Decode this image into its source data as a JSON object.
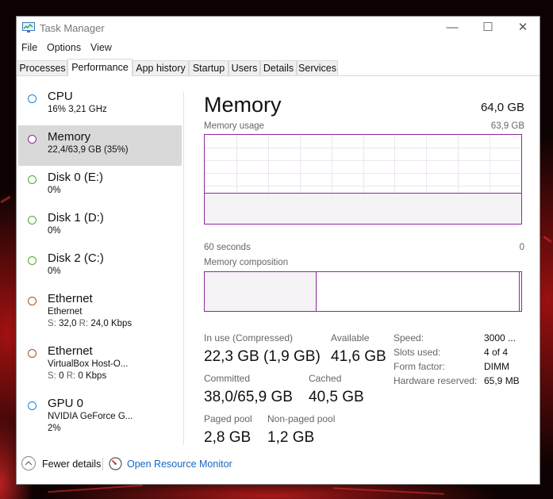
{
  "window": {
    "title": "Task Manager",
    "controls": {
      "minimize": "—",
      "maximize": "☐",
      "close": "✕"
    }
  },
  "menu": [
    "File",
    "Options",
    "View"
  ],
  "tabs": [
    "Processes",
    "Performance",
    "App history",
    "Startup",
    "Users",
    "Details",
    "Services"
  ],
  "active_tab": "Performance",
  "sidebar": {
    "items": [
      {
        "name": "CPU",
        "line1": "16% 3,21 GHz",
        "line2": "",
        "line3": "",
        "color": "#1f82d2"
      },
      {
        "name": "Memory",
        "line1": "22,4/63,9 GB (35%)",
        "line2": "",
        "line3": "",
        "color": "#8b2a9a",
        "selected": true
      },
      {
        "name": "Disk 0 (E:)",
        "line1": "0%",
        "line2": "",
        "line3": "",
        "color": "#4daa2b"
      },
      {
        "name": "Disk 1 (D:)",
        "line1": "0%",
        "line2": "",
        "line3": "",
        "color": "#4daa2b"
      },
      {
        "name": "Disk 2 (C:)",
        "line1": "0%",
        "line2": "",
        "line3": "",
        "color": "#4daa2b"
      },
      {
        "name": "Ethernet",
        "line1": "Ethernet",
        "line2_s_label": "S:",
        "line2_s": "32,0",
        "line2_r_label": "R:",
        "line2_r": "24,0 Kbps",
        "color": "#a7521e"
      },
      {
        "name": "Ethernet",
        "line1": "VirtualBox Host-O...",
        "line2_s_label": "S:",
        "line2_s": "0",
        "line2_r_label": "R:",
        "line2_r": "0 Kbps",
        "color": "#a7521e"
      },
      {
        "name": "GPU 0",
        "line1": "NVIDIA GeForce G...",
        "line2": "2%",
        "line3": "",
        "color": "#1f82d2"
      }
    ]
  },
  "memory": {
    "title": "Memory",
    "capacity": "64,0 GB",
    "usage_label": "Memory usage",
    "usage_max": "63,9 GB",
    "time_left": "60 seconds",
    "time_right": "0",
    "usage_fraction": 0.35,
    "composition_label": "Memory composition",
    "composition_in_use_fraction": 0.35,
    "composition_modified_fraction": 0.005,
    "in_use_label": "In use (Compressed)",
    "in_use_value": "22,3 GB (1,9 GB)",
    "available_label": "Available",
    "available_value": "41,6 GB",
    "committed_label": "Committed",
    "committed_value": "38,0/65,9 GB",
    "cached_label": "Cached",
    "cached_value": "40,5 GB",
    "paged_label": "Paged pool",
    "paged_value": "2,8 GB",
    "nonpaged_label": "Non-paged pool",
    "nonpaged_value": "1,2 GB",
    "speed_label": "Speed:",
    "speed_value": "3000 ...",
    "slots_label": "Slots used:",
    "slots_value": "4 of 4",
    "form_label": "Form factor:",
    "form_value": "DIMM",
    "hwres_label": "Hardware reserved:",
    "hwres_value": "65,9 MB",
    "accent": "#8b2a9a",
    "fill": "#f4f2f4"
  },
  "footer": {
    "fewer_details": "Fewer details",
    "open_resource_monitor": "Open Resource Monitor"
  }
}
